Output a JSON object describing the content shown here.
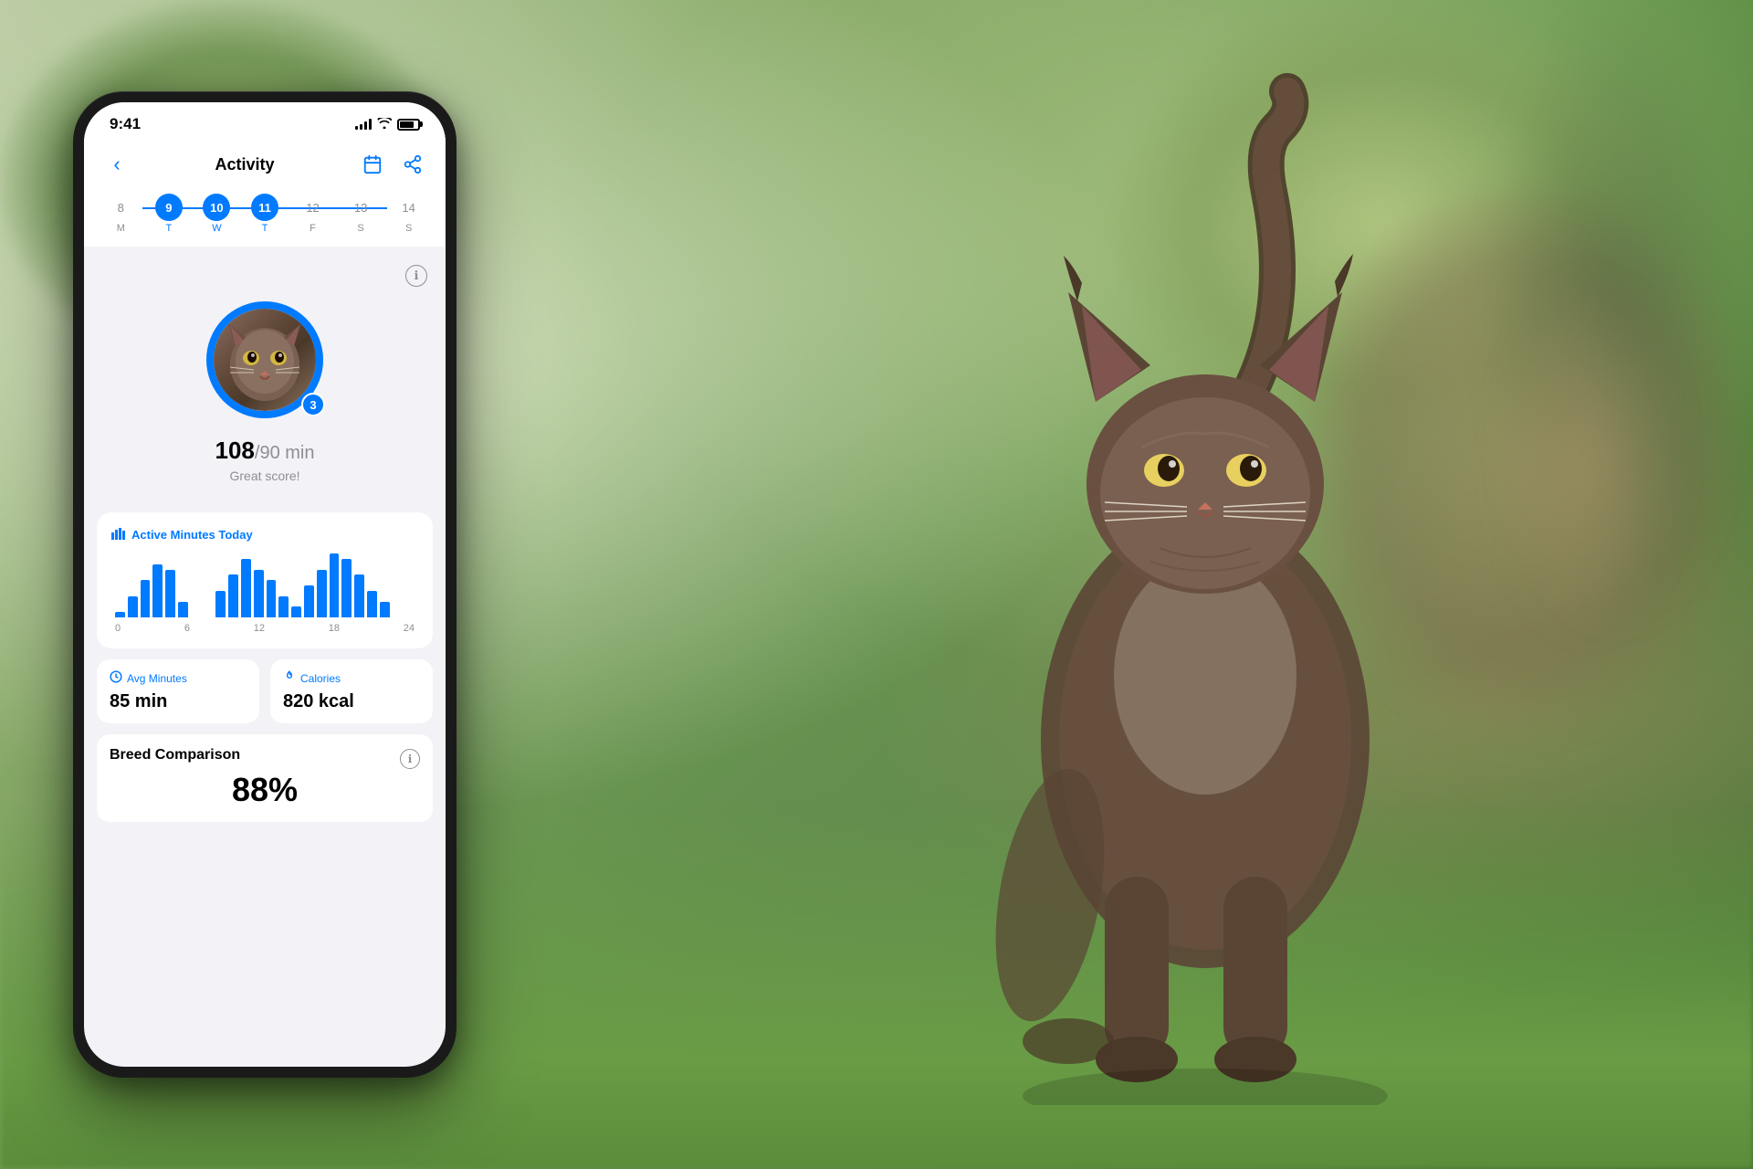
{
  "background": {
    "colors": {
      "primary": "#6a9a50",
      "secondary": "#b8c9a0"
    }
  },
  "phone": {
    "status_bar": {
      "time": "9:41",
      "signal": "signal",
      "wifi": "wifi",
      "battery": "battery"
    },
    "header": {
      "back_label": "‹",
      "title": "Activity",
      "calendar_icon": "calendar",
      "share_icon": "share"
    },
    "date_selector": {
      "dates": [
        {
          "num": "8",
          "day": "M",
          "state": "inactive"
        },
        {
          "num": "9",
          "day": "T",
          "state": "active"
        },
        {
          "num": "10",
          "day": "W",
          "state": "active"
        },
        {
          "num": "11",
          "day": "T",
          "state": "active"
        },
        {
          "num": "12",
          "day": "F",
          "state": "inactive"
        },
        {
          "num": "13",
          "day": "S",
          "state": "inactive"
        },
        {
          "num": "14",
          "day": "S",
          "state": "inactive"
        }
      ]
    },
    "score_section": {
      "score": "108",
      "goal": "/90 min",
      "label": "Great score!",
      "badge": "3",
      "info": "ℹ"
    },
    "active_minutes": {
      "title": "Active Minutes Today",
      "icon": "bar-chart",
      "chart_bars": [
        2,
        8,
        14,
        20,
        18,
        6,
        0,
        0,
        10,
        16,
        22,
        18,
        14,
        8,
        4,
        12,
        18,
        24,
        22,
        16,
        10,
        6,
        0,
        0
      ],
      "labels": [
        "0",
        "6",
        "12",
        "18",
        "24"
      ]
    },
    "stats": [
      {
        "icon": "clock",
        "label": "Avg Minutes",
        "value": "85 min"
      },
      {
        "icon": "fire",
        "label": "Calories",
        "value": "820 kcal"
      }
    ],
    "breed_comparison": {
      "title": "Breed Comparison",
      "percentage": "88%",
      "info": "ℹ"
    }
  }
}
